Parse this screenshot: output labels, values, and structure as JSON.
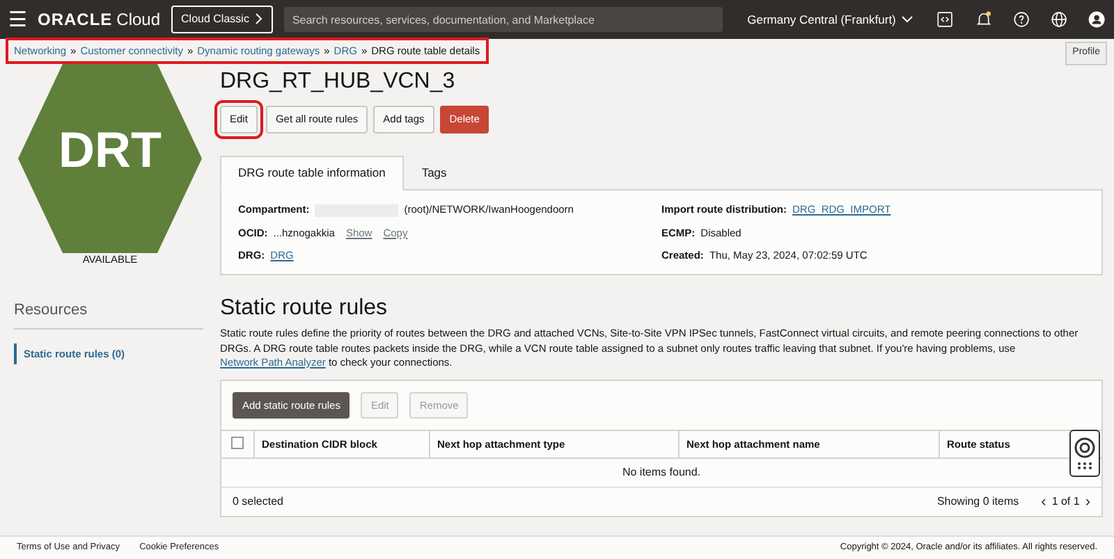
{
  "header": {
    "menu_icon": "☰",
    "logo": "ORACLE",
    "logo_suffix": "Cloud",
    "classic_button": "Cloud Classic",
    "search": {
      "placeholder": "Search resources, services, documentation, and Marketplace"
    },
    "region": "Germany Central (Frankfurt)",
    "tooltip": "Profile"
  },
  "breadcrumb": {
    "highlighted": true,
    "separator": "»",
    "items": [
      {
        "label": "Networking",
        "link": true
      },
      {
        "label": "Customer connectivity",
        "link": true
      },
      {
        "label": "Dynamic routing gateways",
        "link": true
      },
      {
        "label": "DRG",
        "link": true
      },
      {
        "label": "DRG route table details",
        "link": false
      }
    ]
  },
  "resource": {
    "abbr": "DRT",
    "status": "AVAILABLE",
    "color": "#5f7f3b"
  },
  "sidebar": {
    "title": "Resources",
    "items": [
      {
        "label": "Static route rules (0)",
        "selected": true
      }
    ]
  },
  "title": "DRG_RT_HUB_VCN_3",
  "actions": [
    {
      "label": "Edit",
      "kind": "default",
      "highlighted": true
    },
    {
      "label": "Get all route rules",
      "kind": "default"
    },
    {
      "label": "Add tags",
      "kind": "default"
    },
    {
      "label": "Delete",
      "kind": "danger"
    }
  ],
  "tabs": [
    {
      "label": "DRG route table information",
      "selected": true
    },
    {
      "label": "Tags",
      "selected": false
    }
  ],
  "info": {
    "left": [
      {
        "label": "Compartment:",
        "redacted": true,
        "value": "(root)/NETWORK/IwanHoogendoorn"
      },
      {
        "label": "OCID:",
        "value": "...hznogakkia",
        "links": [
          "Show",
          "Copy"
        ]
      },
      {
        "label": "DRG:",
        "link": "DRG"
      }
    ],
    "right": [
      {
        "label": "Import route distribution:",
        "link": "DRG_RDG_IMPORT"
      },
      {
        "label": "ECMP:",
        "value": "Disabled"
      },
      {
        "label": "Created:",
        "value": "Thu, May 23, 2024, 07:02:59 UTC"
      }
    ]
  },
  "section": {
    "title": "Static route rules",
    "text": "Static route rules define the priority of routes between the DRG and attached VCNs, Site-to-Site VPN IPSec tunnels, FastConnect virtual circuits, and remote peering connections to other DRGs. A DRG route table routes packets inside the DRG, while a VCN route table assigned to a subnet only routes traffic leaving that subnet. If you're having problems, use",
    "link": "Network Path Analyzer",
    "text_after": "to check your connections."
  },
  "table": {
    "buttons": [
      {
        "label": "Add static route rules",
        "disabled": false
      },
      {
        "label": "Edit",
        "disabled": true
      },
      {
        "label": "Remove",
        "disabled": true
      }
    ],
    "select_all": {
      "checked": false
    },
    "columns": [
      "Destination CIDR block",
      "Next hop attachment type",
      "Next hop attachment name",
      "Route status"
    ],
    "empty": "No items found.",
    "selected_count": "0 selected",
    "showing": "Showing 0 items",
    "page": "1 of 1",
    "prev": "‹",
    "next": "›"
  },
  "footer": {
    "links": [
      "Terms of Use and Privacy",
      "Cookie Preferences"
    ],
    "copyright": "Copyright © 2024, Oracle and/or its affiliates. All rights reserved."
  }
}
